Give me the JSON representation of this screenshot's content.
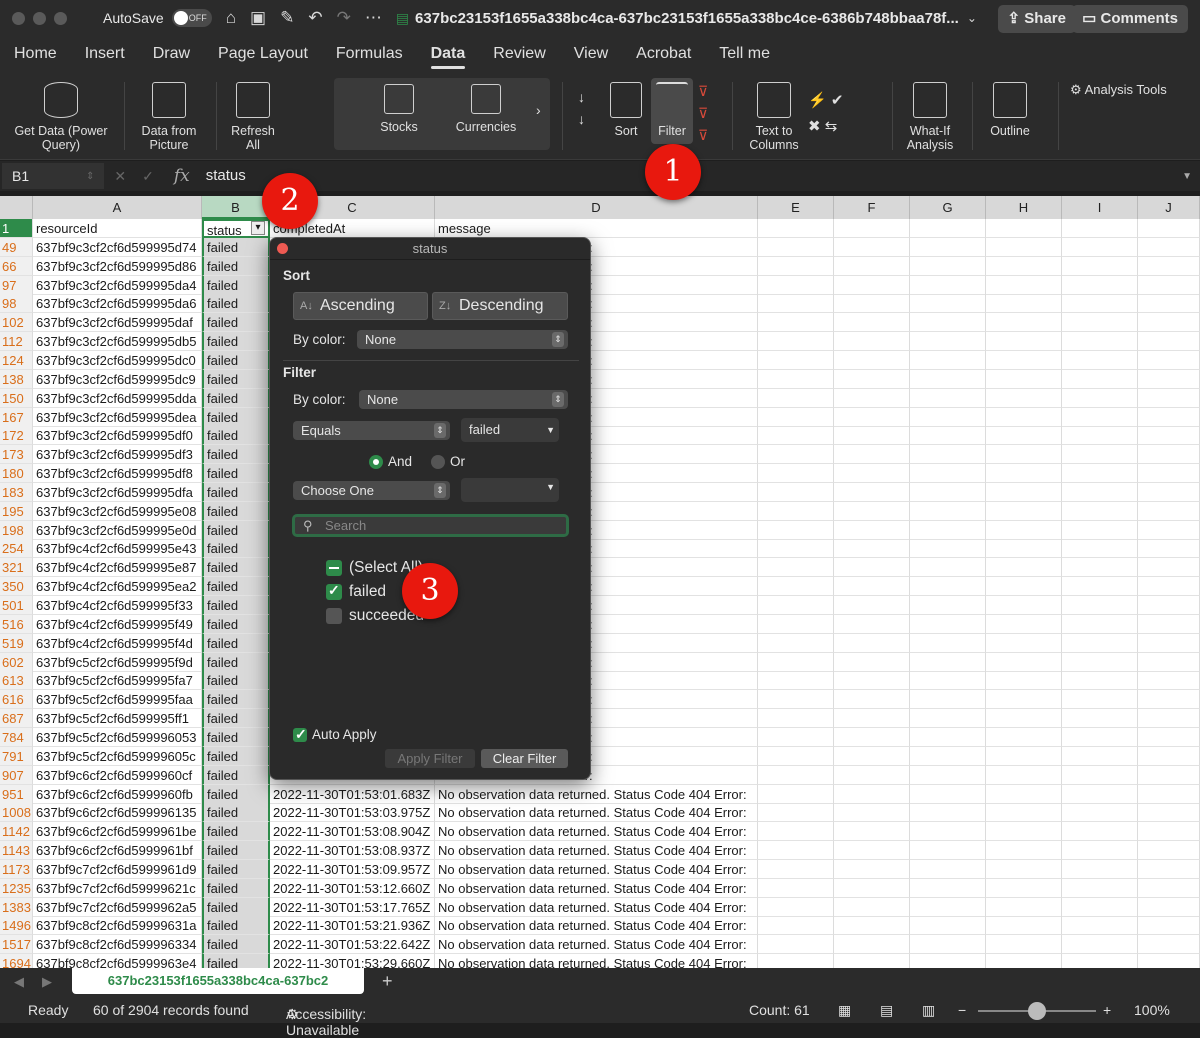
{
  "titlebar": {
    "autosave_label": "AutoSave",
    "autosave_state": "OFF",
    "doc_title": "637bc23153f1655a338bc4ca-637bc23153f1655a338bc4ce-6386b748bbaa78f..."
  },
  "tabs": [
    "Home",
    "Insert",
    "Draw",
    "Page Layout",
    "Formulas",
    "Data",
    "Review",
    "View",
    "Acrobat",
    "Tell me"
  ],
  "active_tab": "Data",
  "share_label": "Share",
  "comments_label": "Comments",
  "ribbon": {
    "get_data": "Get Data (Power Query)",
    "data_from_picture": "Data from Picture",
    "refresh_all": "Refresh All",
    "stocks": "Stocks",
    "currencies": "Currencies",
    "sort": "Sort",
    "filter": "Filter",
    "text_to_columns": "Text to Columns",
    "what_if": "What-If Analysis",
    "outline": "Outline",
    "analysis_tools": "Analysis Tools"
  },
  "formula_bar": {
    "name_box": "B1",
    "fx": "fx",
    "content": "status"
  },
  "grid": {
    "columns": [
      "A",
      "B",
      "C",
      "D",
      "E",
      "F",
      "G",
      "H",
      "I",
      "J"
    ],
    "header_row": {
      "num": "1",
      "a": "resourceId",
      "b": "status",
      "c": "completedAt",
      "d": "message"
    },
    "rows": [
      {
        "num": "49",
        "a": "637bf9c3cf2cf6d599995d74",
        "b": "failed",
        "c": "",
        "d": "ed. Status Code 404 Error:"
      },
      {
        "num": "66",
        "a": "637bf9c3cf2cf6d599995d86",
        "b": "failed",
        "c": "",
        "d": "ed. Status Code 404 Error:"
      },
      {
        "num": "97",
        "a": "637bf9c3cf2cf6d599995da4",
        "b": "failed",
        "c": "",
        "d": "ed. Status Code 404 Error:"
      },
      {
        "num": "98",
        "a": "637bf9c3cf2cf6d599995da6",
        "b": "failed",
        "c": "",
        "d": "ed. Status Code 404 Error:"
      },
      {
        "num": "102",
        "a": "637bf9c3cf2cf6d599995daf",
        "b": "failed",
        "c": "",
        "d": "ed. Status Code 404 Error:"
      },
      {
        "num": "112",
        "a": "637bf9c3cf2cf6d599995db5",
        "b": "failed",
        "c": "",
        "d": "ed. Status Code 404 Error:"
      },
      {
        "num": "124",
        "a": "637bf9c3cf2cf6d599995dc0",
        "b": "failed",
        "c": "",
        "d": "ed. Status Code 404 Error:"
      },
      {
        "num": "138",
        "a": "637bf9c3cf2cf6d599995dc9",
        "b": "failed",
        "c": "",
        "d": "ed. Status Code 404 Error:"
      },
      {
        "num": "150",
        "a": "637bf9c3cf2cf6d599995dda",
        "b": "failed",
        "c": "",
        "d": "ed. Status Code 404 Error:"
      },
      {
        "num": "167",
        "a": "637bf9c3cf2cf6d599995dea",
        "b": "failed",
        "c": "",
        "d": "ed. Status Code 404 Error:"
      },
      {
        "num": "172",
        "a": "637bf9c3cf2cf6d599995df0",
        "b": "failed",
        "c": "",
        "d": "ed. Status Code 404 Error:"
      },
      {
        "num": "173",
        "a": "637bf9c3cf2cf6d599995df3",
        "b": "failed",
        "c": "",
        "d": "ed. Status Code 404 Error:"
      },
      {
        "num": "180",
        "a": "637bf9c3cf2cf6d599995df8",
        "b": "failed",
        "c": "",
        "d": "ed. Status Code 404 Error:"
      },
      {
        "num": "183",
        "a": "637bf9c3cf2cf6d599995dfa",
        "b": "failed",
        "c": "",
        "d": "ed. Status Code 404 Error:"
      },
      {
        "num": "195",
        "a": "637bf9c3cf2cf6d599995e08",
        "b": "failed",
        "c": "",
        "d": "ed. Status Code 404 Error:"
      },
      {
        "num": "198",
        "a": "637bf9c3cf2cf6d599995e0d",
        "b": "failed",
        "c": "",
        "d": "ed. Status Code 404 Error:"
      },
      {
        "num": "254",
        "a": "637bf9c4cf2cf6d599995e43",
        "b": "failed",
        "c": "",
        "d": "ed. Status Code 404 Error:"
      },
      {
        "num": "321",
        "a": "637bf9c4cf2cf6d599995e87",
        "b": "failed",
        "c": "",
        "d": "ed. Status Code 404 Error:"
      },
      {
        "num": "350",
        "a": "637bf9c4cf2cf6d599995ea2",
        "b": "failed",
        "c": "",
        "d": "ed. Status Code 404 Error:"
      },
      {
        "num": "501",
        "a": "637bf9c4cf2cf6d599995f33",
        "b": "failed",
        "c": "",
        "d": "ed. Status Code 404 Error:"
      },
      {
        "num": "516",
        "a": "637bf9c4cf2cf6d599995f49",
        "b": "failed",
        "c": "",
        "d": "ed. Status Code 404 Error:"
      },
      {
        "num": "519",
        "a": "637bf9c4cf2cf6d599995f4d",
        "b": "failed",
        "c": "",
        "d": "ed. Status Code 404 Error:"
      },
      {
        "num": "602",
        "a": "637bf9c5cf2cf6d599995f9d",
        "b": "failed",
        "c": "",
        "d": "ed. Status Code 404 Error:"
      },
      {
        "num": "613",
        "a": "637bf9c5cf2cf6d599995fa7",
        "b": "failed",
        "c": "",
        "d": "ed. Status Code 404 Error:"
      },
      {
        "num": "616",
        "a": "637bf9c5cf2cf6d599995faa",
        "b": "failed",
        "c": "",
        "d": "ed. Status Code 404 Error:"
      },
      {
        "num": "687",
        "a": "637bf9c5cf2cf6d599995ff1",
        "b": "failed",
        "c": "",
        "d": "ed. Status Code 404 Error:"
      },
      {
        "num": "784",
        "a": "637bf9c5cf2cf6d599996053",
        "b": "failed",
        "c": "",
        "d": "ed. Status Code 404 Error:"
      },
      {
        "num": "791",
        "a": "637bf9c5cf2cf6d59999605c",
        "b": "failed",
        "c": "",
        "d": "ed. Status Code 404 Error:"
      },
      {
        "num": "907",
        "a": "637bf9c6cf2cf6d5999960cf",
        "b": "failed",
        "c": "",
        "d": "ed. Status Code 404 Error:"
      },
      {
        "num": "951",
        "a": "637bf9c6cf2cf6d5999960fb",
        "b": "failed",
        "c": "2022-11-30T01:53:01.683Z",
        "d": "No observation data returned. Status Code 404 Error:"
      },
      {
        "num": "1008",
        "a": "637bf9c6cf2cf6d599996135",
        "b": "failed",
        "c": "2022-11-30T01:53:03.975Z",
        "d": "No observation data returned. Status Code 404 Error:"
      },
      {
        "num": "1142",
        "a": "637bf9c6cf2cf6d5999961be",
        "b": "failed",
        "c": "2022-11-30T01:53:08.904Z",
        "d": "No observation data returned. Status Code 404 Error:"
      },
      {
        "num": "1143",
        "a": "637bf9c6cf2cf6d5999961bf",
        "b": "failed",
        "c": "2022-11-30T01:53:08.937Z",
        "d": "No observation data returned. Status Code 404 Error:"
      },
      {
        "num": "1173",
        "a": "637bf9c7cf2cf6d5999961d9",
        "b": "failed",
        "c": "2022-11-30T01:53:09.957Z",
        "d": "No observation data returned. Status Code 404 Error:"
      },
      {
        "num": "1235",
        "a": "637bf9c7cf2cf6d59999621c",
        "b": "failed",
        "c": "2022-11-30T01:53:12.660Z",
        "d": "No observation data returned. Status Code 404 Error:"
      },
      {
        "num": "1383",
        "a": "637bf9c7cf2cf6d5999962a5",
        "b": "failed",
        "c": "2022-11-30T01:53:17.765Z",
        "d": "No observation data returned. Status Code 404 Error:"
      },
      {
        "num": "1496",
        "a": "637bf9c8cf2cf6d59999631a",
        "b": "failed",
        "c": "2022-11-30T01:53:21.936Z",
        "d": "No observation data returned. Status Code 404 Error:"
      },
      {
        "num": "1517",
        "a": "637bf9c8cf2cf6d599996334",
        "b": "failed",
        "c": "2022-11-30T01:53:22.642Z",
        "d": "No observation data returned. Status Code 404 Error:"
      },
      {
        "num": "1694",
        "a": "637bf9c8cf2cf6d5999963e4",
        "b": "failed",
        "c": "2022-11-30T01:53:29.660Z",
        "d": "No observation data returned. Status Code 404 Error:"
      }
    ]
  },
  "filter_popup": {
    "title": "status",
    "sort_heading": "Sort",
    "ascending": "Ascending",
    "descending": "Descending",
    "by_color_label": "By color:",
    "sort_color_value": "None",
    "filter_heading": "Filter",
    "filter_color_value": "None",
    "condition1": "Equals",
    "condition1_value": "failed",
    "and_label": "And",
    "or_label": "Or",
    "condition2": "Choose One",
    "search_placeholder": "Search",
    "select_all": "(Select All)",
    "option_failed": "failed",
    "option_succeeded": "succeeded",
    "auto_apply": "Auto Apply",
    "apply_filter": "Apply Filter",
    "clear_filter": "Clear Filter"
  },
  "badges": [
    "1",
    "2",
    "3"
  ],
  "sheet_tab": "637bc23153f1655a338bc4ca-637bc2",
  "statusbar": {
    "ready": "Ready",
    "records": "60 of 2904 records found",
    "accessibility": "Accessibility: Unavailable",
    "count": "Count: 61",
    "zoom": "100%"
  },
  "colors": {
    "accent_green": "#2e8b4a",
    "badge_red": "#e8180e",
    "row_number_orange": "#d96e1a"
  }
}
